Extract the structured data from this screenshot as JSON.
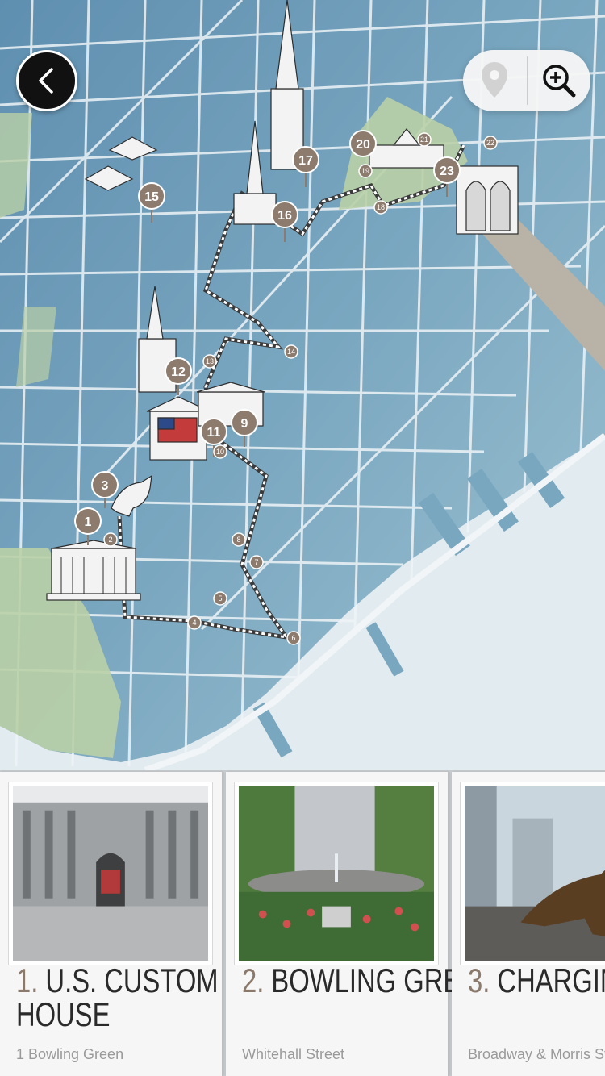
{
  "map": {
    "markers_big": [
      "1",
      "3",
      "9",
      "11",
      "12",
      "15",
      "16",
      "17",
      "20",
      "23"
    ],
    "markers_small": [
      "2",
      "4",
      "5",
      "6",
      "8",
      "7",
      "10",
      "13",
      "14",
      "18",
      "19",
      "21",
      "22"
    ]
  },
  "toolbar": {
    "back_icon": "chevron-left-icon",
    "pin_icon": "map-pin-icon",
    "zoom_icon": "zoom-in-icon"
  },
  "cards": [
    {
      "num": "1.",
      "name_line1": "U.S. CUSTOM",
      "name_line2": "HOUSE",
      "address": "1 Bowling Green"
    },
    {
      "num": "2.",
      "name_line1": "BOWLING GREEN",
      "name_line2": "",
      "address": "Whitehall Street"
    },
    {
      "num": "3.",
      "name_line1": "CHARGING BULL",
      "name_line2": "",
      "address": "Broadway & Morris Street"
    }
  ],
  "colors": {
    "water": "#dfe9ee",
    "marker": "#8d7b6d",
    "park": "#b9cfa6",
    "block": "#6e9bb5"
  }
}
